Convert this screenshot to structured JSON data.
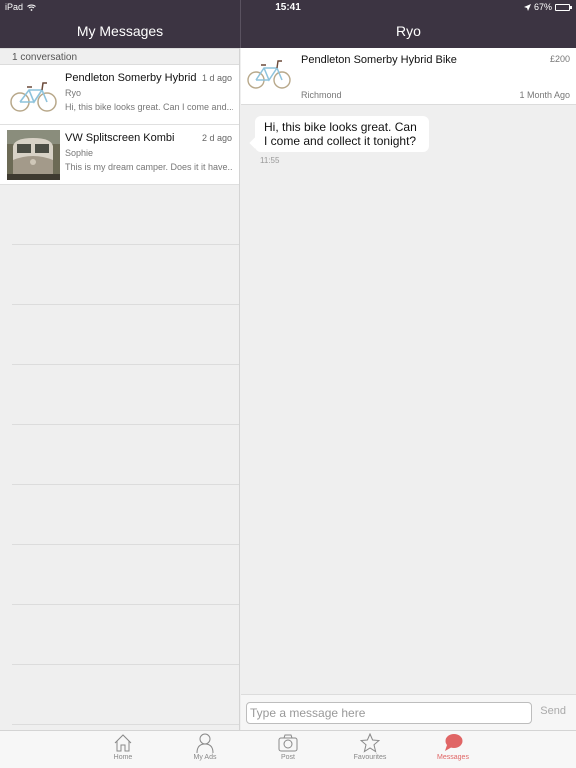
{
  "status_bar": {
    "device": "iPad",
    "time": "15:41",
    "battery": "67%",
    "battery_level": 0.67
  },
  "header": {
    "left_title": "My Messages",
    "right_title": "Ryo"
  },
  "conversations": {
    "count_label": "1 conversation",
    "items": [
      {
        "title": "Pendleton Somerby Hybrid",
        "date": "1 d ago",
        "user": "Ryo",
        "preview": "Hi, this bike looks great. Can I come and...",
        "thumb": "bike-thumbnail"
      },
      {
        "title": "VW Splitscreen Kombi",
        "date": "2 d ago",
        "user": "Sophie",
        "preview": "This is my dream camper. Does it it have...",
        "thumb": "van-thumbnail"
      }
    ]
  },
  "ad": {
    "title": "Pendleton Somerby Hybrid Bike",
    "price": "£200",
    "location": "Richmond",
    "age": "1 Month Ago"
  },
  "messages": [
    {
      "text": "Hi, this bike looks great. Can I come and collect it tonight?",
      "time": "11:55"
    }
  ],
  "composer": {
    "placeholder": "Type a message here",
    "value": "",
    "send_label": "Send"
  },
  "tabbar": {
    "active_color": "#e06565",
    "items": [
      {
        "label": "Home",
        "icon": "home-icon"
      },
      {
        "label": "My Ads",
        "icon": "person-icon"
      },
      {
        "label": "Post",
        "icon": "camera-icon"
      },
      {
        "label": "Favourites",
        "icon": "star-icon"
      },
      {
        "label": "Messages",
        "icon": "chat-bubble-icon",
        "active": true
      }
    ]
  }
}
